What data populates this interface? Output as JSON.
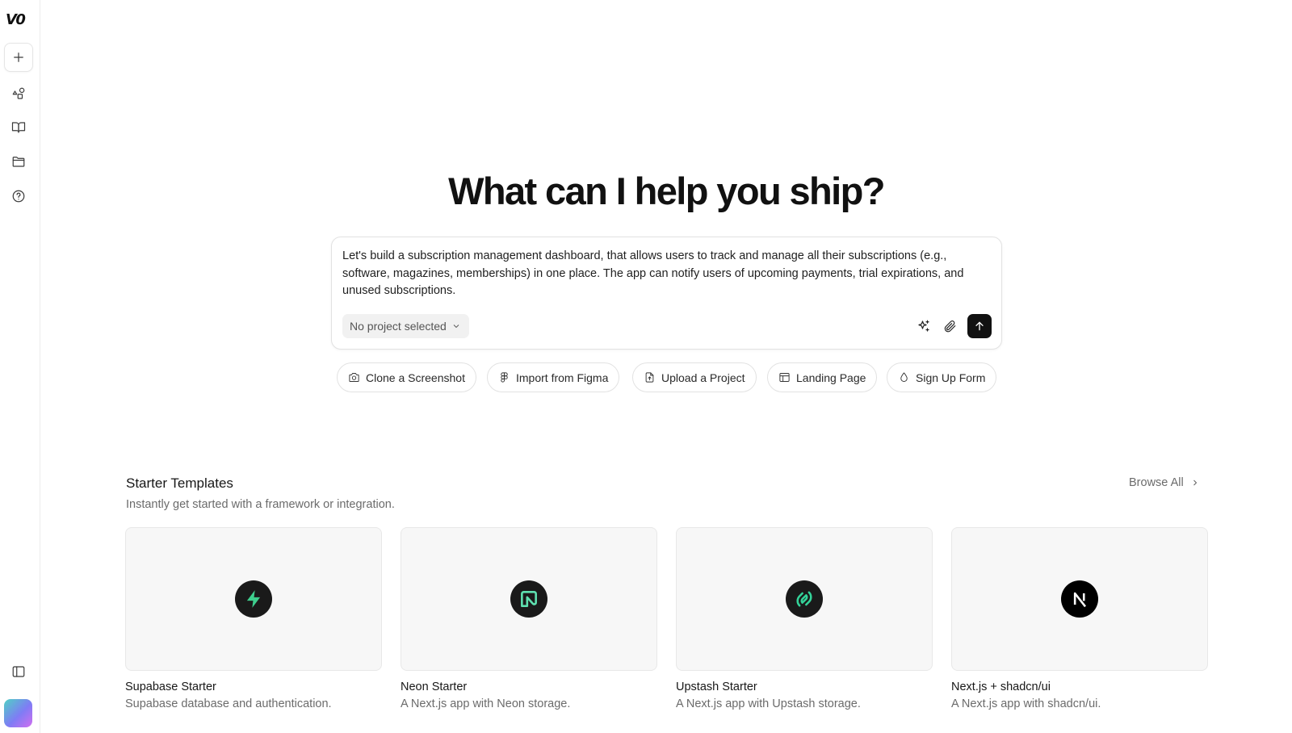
{
  "sidebar": {
    "logo_text": "V0",
    "items": [
      {
        "name": "new-chat",
        "icon": "plus-icon"
      },
      {
        "name": "community",
        "icon": "shapes-icon"
      },
      {
        "name": "library",
        "icon": "book-icon"
      },
      {
        "name": "projects",
        "icon": "folder-icon"
      },
      {
        "name": "help",
        "icon": "help-circle-icon"
      },
      {
        "name": "toggle-sidebar",
        "icon": "panel-left-icon"
      }
    ]
  },
  "hero": {
    "title": "What can I help you ship?"
  },
  "prompt": {
    "value": "Let's build a subscription management dashboard,  that allows users to track and manage all their subscriptions (e.g., software, magazines, memberships) in one place. The app can notify users of upcoming payments, trial expirations, and unused subscriptions.",
    "project_select": "No project selected"
  },
  "chips": [
    {
      "label": "Clone a Screenshot",
      "icon": "camera-icon"
    },
    {
      "label": "Import from Figma",
      "icon": "figma-icon"
    },
    {
      "label": "Upload a Project",
      "icon": "file-upload-icon"
    },
    {
      "label": "Landing Page",
      "icon": "layout-icon"
    },
    {
      "label": "Sign Up Form",
      "icon": "droplet-icon"
    }
  ],
  "templates": {
    "title": "Starter Templates",
    "subtitle": "Instantly get started with a framework or integration.",
    "browse_label": "Browse All",
    "items": [
      {
        "name": "Supabase Starter",
        "desc": "Supabase database and authentication.",
        "icon": "supabase-logo-icon",
        "accent": "#3ecf8e"
      },
      {
        "name": "Neon Starter",
        "desc": "A Next.js app with Neon storage.",
        "icon": "neon-logo-icon",
        "accent": "#37c38f"
      },
      {
        "name": "Upstash Starter",
        "desc": "A Next.js app with Upstash storage.",
        "icon": "upstash-logo-icon",
        "accent": "#34d399"
      },
      {
        "name": "Next.js + shadcn/ui",
        "desc": "A Next.js app with shadcn/ui.",
        "icon": "nextjs-logo-icon",
        "accent": "#000000"
      }
    ]
  }
}
